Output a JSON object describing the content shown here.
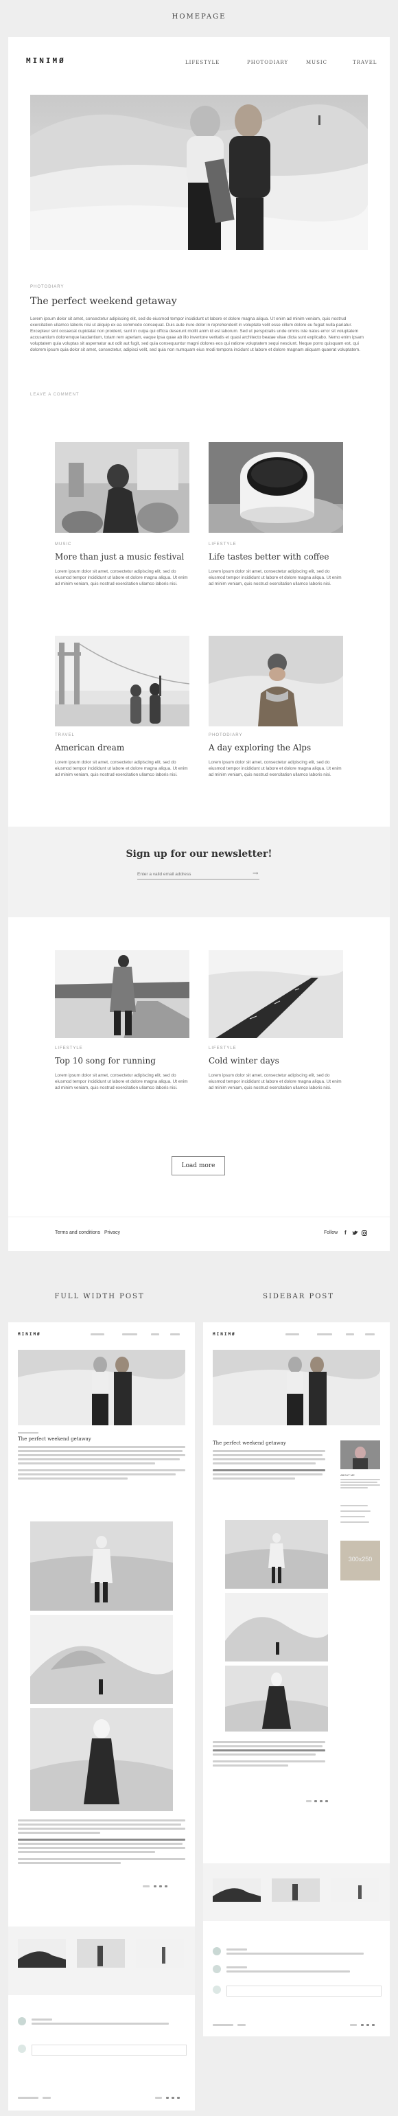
{
  "sections": {
    "homepage": "HOMEPAGE",
    "full_width": "FULL WIDTH POST",
    "sidebar": "SIDEBAR POST"
  },
  "brand": {
    "logo": "MINIMØ"
  },
  "nav": [
    "LIFESTYLE",
    "PHOTODIARY",
    "MUSIC",
    "TRAVEL"
  ],
  "featured": {
    "kicker": "PHOTODIARY",
    "title": "The perfect weekend getaway",
    "body": "Lorem ipsum dolor sit amet, consectetur adipiscing elit, sed do eiusmod tempor incididunt ut labore et dolore magna aliqua. Ut enim ad minim veniam, quis nostrud exercitation ullamco laboris nisi ut aliquip ex ea commodo consequat. Duis aute irure dolor in reprehenderit in voluptate velit esse cillum dolore eu fugiat nulla pariatur. Excepteur sint occaecat cupidatat non proident, sunt in culpa qui officia deserunt mollit anim id est laborum. Sed ut perspiciatis unde omnis iste natus error sit voluptatem accusantium doloremque laudantium, totam rem aperiam, eaque ipsa quae ab illo inventore veritatis et quasi architecto beatae vitae dicta sunt explicabo. Nemo enim ipsam voluptatem quia voluptas sit aspernatur aut odit aut fugit, sed quia consequuntur magni dolores eos qui ratione voluptatem sequi nesciunt. Neque porro quisquam est, qui dolorem ipsum quia dolor sit amet, consectetur, adipisci velit, sed quia non numquam eius modi tempora incidunt ut labore et dolore magnam aliquam quaerat voluptatem.",
    "more": "LEAVE A COMMENT"
  },
  "posts": [
    {
      "kicker": "MUSIC",
      "title": "More than just a music festival",
      "body": "Lorem ipsum dolor sit amet, consectetur adipiscing elit, sed do eiusmod tempor incididunt ut labore et dolore magna aliqua. Ut enim ad minim veniam, quis nostrud exercitation ullamco laboris nisi."
    },
    {
      "kicker": "LIFESTYLE",
      "title": "Life tastes better with coffee",
      "body": "Lorem ipsum dolor sit amet, consectetur adipiscing elit, sed do eiusmod tempor incididunt ut labore et dolore magna aliqua. Ut enim ad minim veniam, quis nostrud exercitation ullamco laboris nisi."
    },
    {
      "kicker": "TRAVEL",
      "title": "American dream",
      "body": "Lorem ipsum dolor sit amet, consectetur adipiscing elit, sed do eiusmod tempor incididunt ut labore et dolore magna aliqua. Ut enim ad minim veniam, quis nostrud exercitation ullamco laboris nisi."
    },
    {
      "kicker": "PHOTODIARY",
      "title": "A day exploring the Alps",
      "body": "Lorem ipsum dolor sit amet, consectetur adipiscing elit, sed do eiusmod tempor incididunt ut labore et dolore magna aliqua. Ut enim ad minim veniam, quis nostrud exercitation ullamco laboris nisi."
    },
    {
      "kicker": "LIFESTYLE",
      "title": "Top 10 song for running",
      "body": "Lorem ipsum dolor sit amet, consectetur adipiscing elit, sed do eiusmod tempor incididunt ut labore et dolore magna aliqua. Ut enim ad minim veniam, quis nostrud exercitation ullamco laboris nisi."
    },
    {
      "kicker": "LIFESTYLE",
      "title": "Cold winter days",
      "body": "Lorem ipsum dolor sit amet, consectetur adipiscing elit, sed do eiusmod tempor incididunt ut labore et dolore magna aliqua. Ut enim ad minim veniam, quis nostrud exercitation ullamco laboris nisi."
    }
  ],
  "newsletter": {
    "title": "Sign up for our newsletter!",
    "placeholder": "Enter a valid email address"
  },
  "load_more": "Load more",
  "footer": {
    "terms": "Terms and conditions",
    "privacy": "Privacy",
    "follow": "Follow"
  },
  "mini": {
    "post_title": "The perfect weekend getaway",
    "sidebar_widget": "ABOUT ME",
    "ad": "300x250"
  },
  "colors": {
    "bg": "#eeeeee",
    "card": "#ffffff",
    "text": "#333333",
    "muted": "#999999"
  }
}
